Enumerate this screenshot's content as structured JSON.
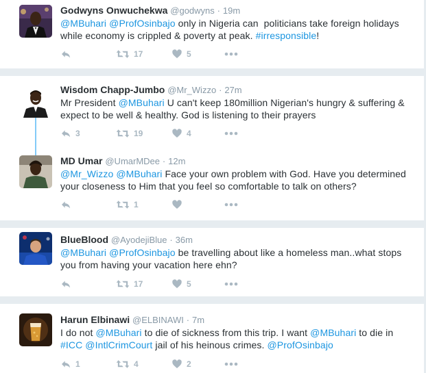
{
  "tweets": [
    {
      "name": "Godwyns Onwuchekwa",
      "handle": "@godwyns",
      "sep": "·",
      "time": "19m",
      "lines": [
        [
          {
            "t": "@MBuhari",
            "l": true
          },
          {
            "t": " "
          },
          {
            "t": "@ProfOsinbajo",
            "l": true
          },
          {
            "t": " only in Nigeria can  politicians take foreign holidays"
          }
        ],
        [
          {
            "t": "while economy is crippled & poverty at peak. "
          },
          {
            "t": "#irresponsible",
            "l": true
          },
          {
            "t": "!"
          }
        ]
      ],
      "replies": "",
      "retweets": "17",
      "likes": "5"
    },
    {
      "name": "Wisdom Chapp-Jumbo",
      "handle": "@Mr_Wizzo",
      "sep": "·",
      "time": "27m",
      "lines": [
        [
          {
            "t": "Mr President "
          },
          {
            "t": "@MBuhari",
            "l": true
          },
          {
            "t": " U can't keep 180million Nigerian's hungry & suffering &"
          }
        ],
        [
          {
            "t": "expect to be well & healthy. God is listening to their prayers"
          }
        ]
      ],
      "replies": "3",
      "retweets": "19",
      "likes": "4"
    },
    {
      "name": "MD Umar",
      "handle": "@UmarMDee",
      "sep": "·",
      "time": "12m",
      "lines": [
        [
          {
            "t": "@Mr_Wizzo",
            "l": true
          },
          {
            "t": " "
          },
          {
            "t": "@MBuhari",
            "l": true
          },
          {
            "t": " Face your own problem with God. Have you determined"
          }
        ],
        [
          {
            "t": "your closeness to Him that you feel so comfortable to talk on others?"
          }
        ]
      ],
      "replies": "",
      "retweets": "1",
      "likes": ""
    },
    {
      "name": "BlueBlood",
      "handle": "@AyodejiBlue",
      "sep": "·",
      "time": "36m",
      "lines": [
        [
          {
            "t": "@MBuhari",
            "l": true
          },
          {
            "t": " "
          },
          {
            "t": "@ProfOsinbajo",
            "l": true
          },
          {
            "t": " be travelling about like a homeless man..what stops"
          }
        ],
        [
          {
            "t": "you from having your vacation here ehn?"
          }
        ]
      ],
      "replies": "",
      "retweets": "17",
      "likes": "5"
    },
    {
      "name": "Harun Elbinawi",
      "handle": "@ELBINAWI",
      "sep": "·",
      "time": "7m",
      "lines": [
        [
          {
            "t": "I do not "
          },
          {
            "t": "@MBuhari",
            "l": true
          },
          {
            "t": " to die of sickness from this trip. I want "
          },
          {
            "t": "@MBuhari",
            "l": true
          },
          {
            "t": " to die in"
          }
        ],
        [
          {
            "t": "#ICC",
            "l": true
          },
          {
            "t": " "
          },
          {
            "t": "@IntlCrimCourt",
            "l": true
          },
          {
            "t": " jail of his heinous crimes. "
          },
          {
            "t": "@ProfOsinbajo",
            "l": true
          }
        ]
      ],
      "replies": "1",
      "retweets": "4",
      "likes": "2"
    }
  ],
  "icons": {
    "reply": "reply-icon",
    "retweet": "retweet-icon",
    "like": "heart-icon",
    "more": "more-icon"
  },
  "colors": {
    "link": "#1b95e0",
    "muted": "#8899a6",
    "action": "#aab8c2",
    "background": "#e6ecf0",
    "thread_line": "#1da1f2"
  }
}
